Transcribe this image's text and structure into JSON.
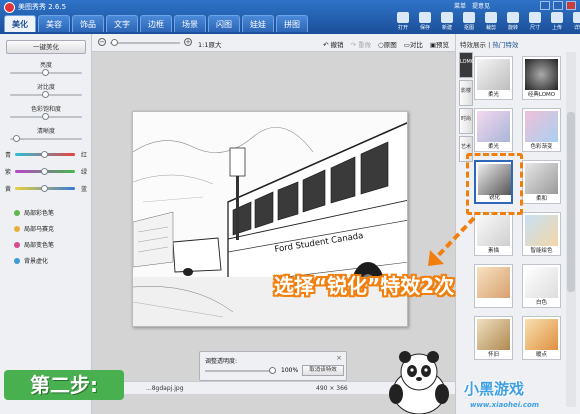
{
  "app": {
    "title": "美图秀秀 2.6.5"
  },
  "top_links": [
    "菜单",
    "提意见"
  ],
  "tabs": [
    {
      "label": "美化",
      "active": true
    },
    {
      "label": "美容"
    },
    {
      "label": "饰品"
    },
    {
      "label": "文字"
    },
    {
      "label": "边框"
    },
    {
      "label": "场景"
    },
    {
      "label": "闪图"
    },
    {
      "label": "娃娃"
    },
    {
      "label": "拼图"
    }
  ],
  "toolbar": [
    "打开",
    "保存",
    "新建",
    "抠图",
    "裁剪",
    "旋转",
    "尺寸",
    "上传",
    "详情"
  ],
  "left": {
    "one_click": "一键美化",
    "adjustments": [
      {
        "label": "亮度",
        "level": 0.5
      },
      {
        "label": "对比度",
        "level": 0.5
      },
      {
        "label": "色彩饱和度",
        "level": 0.5
      },
      {
        "label": "清晰度",
        "level": 0.1
      }
    ],
    "color_balance": [
      {
        "left": "青",
        "right": "红",
        "level": 0.5
      },
      {
        "left": "紫",
        "right": "绿",
        "level": 0.5
      },
      {
        "left": "黄",
        "right": "蓝",
        "level": 0.5
      }
    ],
    "brushes": [
      {
        "label": "局部彩色笔",
        "icon": "color-brush-icon",
        "color": "#5db84a"
      },
      {
        "label": "局部马赛克",
        "icon": "mosaic-icon",
        "color": "#e8b03a"
      },
      {
        "label": "局部变色笔",
        "icon": "recolor-brush-icon",
        "color": "#d94b8c"
      },
      {
        "label": "背景虚化",
        "icon": "blur-icon",
        "color": "#3c9ad8"
      }
    ]
  },
  "canvas_toolbar": {
    "zoom_label": "1:1原大",
    "zoom_level": 0.05,
    "undo": "撤销",
    "redo": "重做",
    "original": "原图",
    "compare": "对比",
    "preview": "预览"
  },
  "photo": {
    "text": "Ford Student Canada"
  },
  "opacity": {
    "label": "调整透明度:",
    "value": "100%",
    "cancel": "取消该特效"
  },
  "status": {
    "filename": "...8gdapj.jpg",
    "size": "490 × 366"
  },
  "right": {
    "header_left": "特效展示",
    "header_right": "热门特效",
    "side_tabs": [
      "LOMO",
      "影楼",
      "时尚",
      "艺术"
    ],
    "thumbs": [
      {
        "label": "柔光",
        "style": "soft"
      },
      {
        "label": "经典LOMO",
        "style": "lomo"
      },
      {
        "label": "柔光",
        "style": "pinkish"
      },
      {
        "label": "色彩渐变",
        "style": "gradient"
      },
      {
        "label": "锐化",
        "style": "sharp",
        "selected": true
      },
      {
        "label": "柔和",
        "style": "gentle"
      },
      {
        "label": "素描",
        "style": "sketch"
      },
      {
        "label": "智能绘色",
        "style": "paint"
      },
      {
        "label": "",
        "style": "warm"
      },
      {
        "label": "白色",
        "style": "white"
      },
      {
        "label": "怀旧",
        "style": "vintage"
      },
      {
        "label": "暖点",
        "style": "warmdot"
      }
    ]
  },
  "overlay": {
    "instruction": "选择“锐化”特效2次",
    "step": "第二步:",
    "watermark": "小黑游戏",
    "watermark_url": "www.xiaohei.com",
    "accent": "#f07f0e"
  }
}
